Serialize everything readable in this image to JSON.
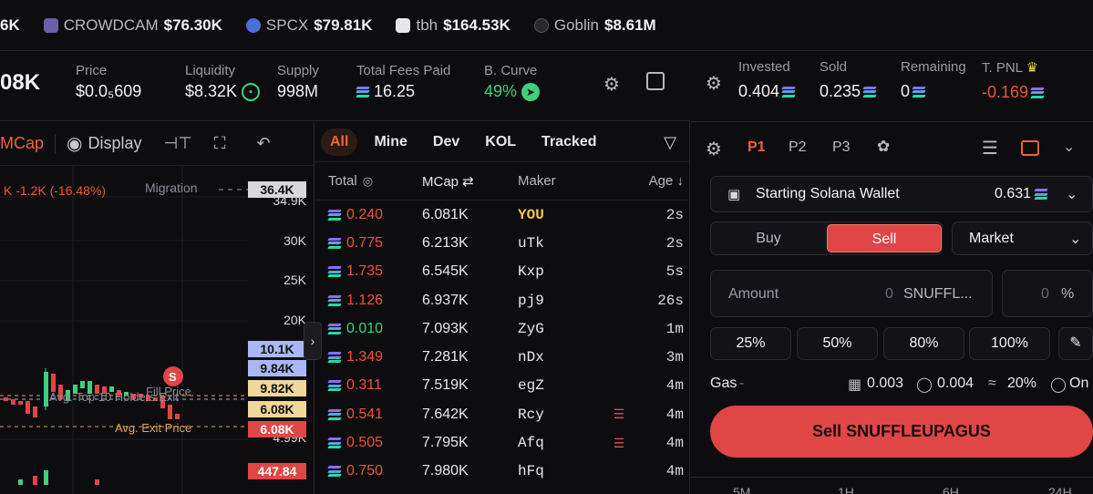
{
  "ticker": [
    {
      "name": "",
      "price": "6K",
      "icon": "none",
      "color": "#ffffff"
    },
    {
      "name": "CROWDCAM",
      "price": "$76.30K",
      "icon": "crowdcam-icon",
      "color": "#6b5fa8"
    },
    {
      "name": "SPCX",
      "price": "$79.81K",
      "icon": "spcx-icon",
      "color": "#4a6fd8"
    },
    {
      "name": "tbh",
      "price": "$164.53K",
      "icon": "tbh-icon",
      "color": "#e8e8ec"
    },
    {
      "name": "Goblin",
      "price": "$8.61M",
      "icon": "goblin-icon",
      "color": "#222226"
    }
  ],
  "stats": {
    "mcap": "08K",
    "price_label": "Price",
    "price_value": "$0.0₅609",
    "liquidity_label": "Liquidity",
    "liquidity_value": "$8.32K",
    "supply_label": "Supply",
    "supply_value": "998M",
    "fees_label": "Total Fees Paid",
    "fees_value": "16.25",
    "curve_label": "B. Curve",
    "curve_value": "49%"
  },
  "chart_toolbar": {
    "mcap_label": "MCap",
    "display_label": "Display"
  },
  "chart": {
    "change_text": "K -1.2K (-16.48%)",
    "migration_label": "Migration",
    "axis_labels": [
      "34.9K",
      "30K",
      "25K",
      "20K",
      "4.99K"
    ],
    "pills": [
      {
        "text": "36.4K",
        "bg": "#d8d8dc",
        "fg": "#111111"
      },
      {
        "text": "10.1K",
        "bg": "#a9b8f2",
        "fg": "#111111"
      },
      {
        "text": "9.84K",
        "bg": "#a9b8f2",
        "fg": "#111111"
      },
      {
        "text": "9.82K",
        "bg": "#f0d79a",
        "fg": "#111111"
      },
      {
        "text": "6.08K",
        "bg": "#f0d79a",
        "fg": "#111111"
      },
      {
        "text": "6.08K",
        "bg": "#e04646",
        "fg": "#ffffff"
      },
      {
        "text": "447.84",
        "bg": "#e04646",
        "fg": "#ffffff"
      }
    ],
    "overlay_labels": [
      "Avg. Exit Price",
      "Avg. Top 10 Holders Exit",
      "Fill Price"
    ],
    "marker_label": "S"
  },
  "trades": {
    "tabs": [
      "All",
      "Mine",
      "Dev",
      "KOL",
      "Tracked"
    ],
    "active_tab": "All",
    "headers": {
      "total": "Total",
      "mcap": "MCap",
      "maker": "Maker",
      "age": "Age"
    },
    "rows": [
      {
        "total": "0.240",
        "type": "sell",
        "mcap": "6.081K",
        "maker": "YOU",
        "age": "2s",
        "flag": ""
      },
      {
        "total": "0.775",
        "type": "sell",
        "mcap": "6.213K",
        "maker": "uTk",
        "age": "2s",
        "flag": ""
      },
      {
        "total": "1.735",
        "type": "sell",
        "mcap": "6.545K",
        "maker": "Kxp",
        "age": "5s",
        "flag": ""
      },
      {
        "total": "1.126",
        "type": "sell",
        "mcap": "6.937K",
        "maker": "pj9",
        "age": "26s",
        "flag": ""
      },
      {
        "total": "0.010",
        "type": "buy",
        "mcap": "7.093K",
        "maker": "ZyG",
        "age": "1m",
        "flag": ""
      },
      {
        "total": "1.349",
        "type": "sell",
        "mcap": "7.281K",
        "maker": "nDx",
        "age": "3m",
        "flag": ""
      },
      {
        "total": "0.311",
        "type": "sell",
        "mcap": "7.519K",
        "maker": "egZ",
        "age": "4m",
        "flag": ""
      },
      {
        "total": "0.541",
        "type": "sell",
        "mcap": "7.642K",
        "maker": "Rcy",
        "age": "4m",
        "flag": "layers"
      },
      {
        "total": "0.505",
        "type": "sell",
        "mcap": "7.795K",
        "maker": "Afq",
        "age": "4m",
        "flag": "layers"
      },
      {
        "total": "0.750",
        "type": "sell",
        "mcap": "7.980K",
        "maker": "hFq",
        "age": "4m",
        "flag": ""
      }
    ]
  },
  "position": {
    "invested_label": "Invested",
    "invested_value": "0.404",
    "sold_label": "Sold",
    "sold_value": "0.235",
    "remaining_label": "Remaining",
    "remaining_value": "0",
    "pnl_label": "T. PNL",
    "pnl_value": "-0.169"
  },
  "presets": [
    "P1",
    "P2",
    "P3"
  ],
  "active_preset": "P1",
  "wallet": {
    "label": "Starting Solana Wallet",
    "balance": "0.631"
  },
  "order": {
    "buy_label": "Buy",
    "sell_label": "Sell",
    "type_label": "Market",
    "amount_label": "Amount",
    "amount_value": "0",
    "amount_unit": "SNUFFL...",
    "pct_value": "0",
    "pct_unit": "%",
    "percent_buttons": [
      "25%",
      "50%",
      "80%",
      "100%"
    ]
  },
  "gas": {
    "label": "Gas",
    "dash": "-",
    "fee1": "0.003",
    "fee2": "0.004",
    "slippage": "20%",
    "mev": "On"
  },
  "sell_button": "Sell SNUFFLEUPAGUS",
  "timeframes": [
    "5M",
    "1H",
    "6H",
    "24H"
  ],
  "colors": {
    "accent": "#f0623a",
    "sell": "#e04646",
    "buy": "#3fd07c",
    "you": "#f2c744"
  }
}
